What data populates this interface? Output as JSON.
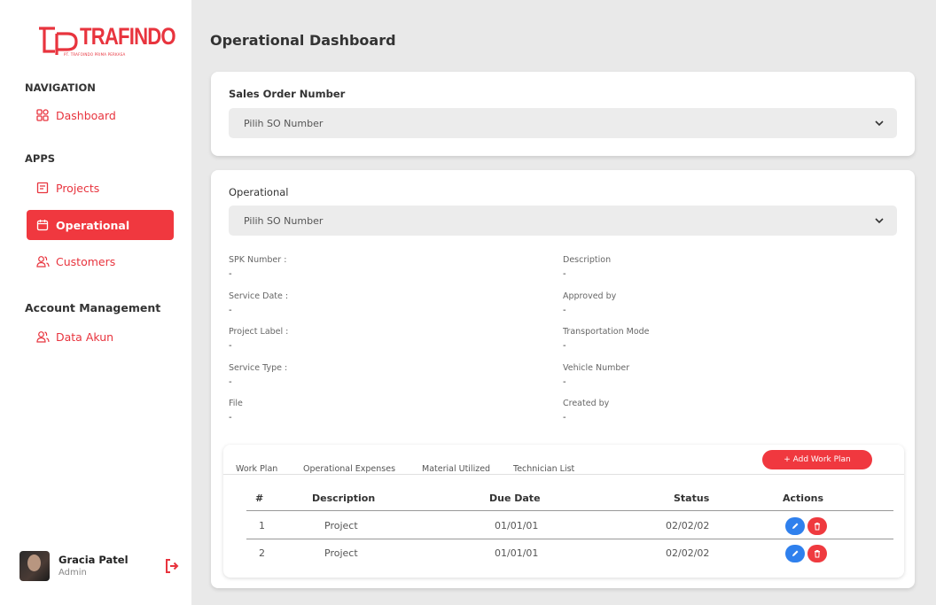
{
  "brand": {
    "name": "TRAFINDO",
    "tagline": "PT. TRAFOINDO PRIMA PERKASA",
    "color": "#e8343e"
  },
  "sidebar": {
    "nav_heading": "NAVIGATION",
    "apps_heading": "APPS",
    "account_heading": "Account Management",
    "items": [
      {
        "label": "Dashboard",
        "icon": "grid-icon"
      },
      {
        "label": "Projects",
        "icon": "folder-icon"
      },
      {
        "label": "Operational",
        "icon": "calendar-icon",
        "active": true
      },
      {
        "label": "Customers",
        "icon": "users-icon"
      },
      {
        "label": "Data Akun",
        "icon": "users-icon"
      }
    ],
    "user": {
      "name": "Gracia Patel",
      "role": "Admin"
    }
  },
  "page": {
    "title": "Operational Dashboard"
  },
  "sales_order": {
    "label": "Sales Order Number",
    "select_value": "Pilih SO Number"
  },
  "operational": {
    "label": "Operational",
    "select_value": "Pilih SO Number",
    "fields_left": [
      {
        "label": "SPK Number :",
        "value": "-"
      },
      {
        "label": "Service Date :",
        "value": "-"
      },
      {
        "label": "Project Label :",
        "value": "-"
      },
      {
        "label": "Service Type :",
        "value": "-"
      },
      {
        "label": "File",
        "value": "-"
      }
    ],
    "fields_right": [
      {
        "label": "Description",
        "value": "-"
      },
      {
        "label": "Approved by",
        "value": "-"
      },
      {
        "label": "Transportation Mode",
        "value": "-"
      },
      {
        "label": "Vehicle Number",
        "value": "-"
      },
      {
        "label": "Created by",
        "value": "-"
      }
    ]
  },
  "tabs": [
    "Work Plan",
    "Operational Expenses",
    "Material Utilized",
    "Technician List"
  ],
  "add_button": "+ Add Work Plan",
  "table": {
    "headers": [
      "#",
      "Description",
      "Due Date",
      "Status",
      "Actions"
    ],
    "rows": [
      {
        "no": "1",
        "description": "Project",
        "due_date": "01/01/01",
        "status": "02/02/02"
      },
      {
        "no": "2",
        "description": "Project",
        "due_date": "01/01/01",
        "status": "02/02/02"
      }
    ]
  },
  "colors": {
    "accent": "#f0383f",
    "edit": "#2f80ed",
    "delete": "#ef3a3f"
  }
}
